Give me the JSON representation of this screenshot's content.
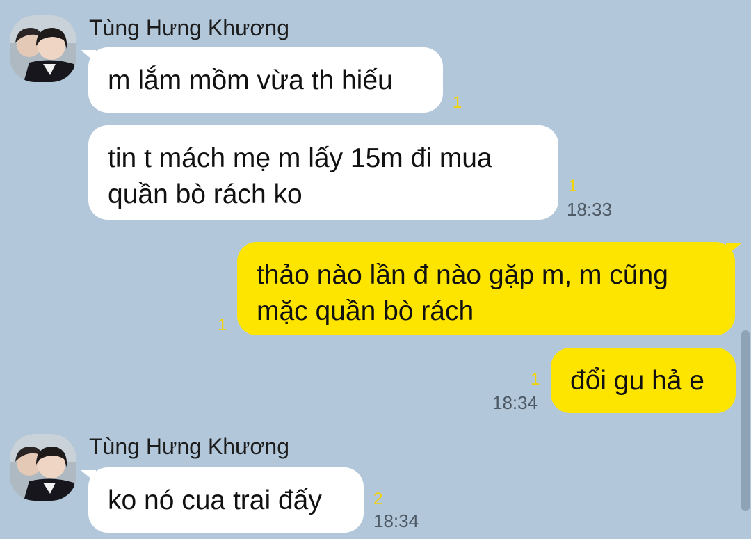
{
  "contact": {
    "name": "Tùng Hưng Khương",
    "avatar_icon": "profile-photo-icon"
  },
  "colors": {
    "background": "#b2c7da",
    "incoming_bubble": "#ffffff",
    "outgoing_bubble": "#fee500",
    "unread": "#f5d400"
  },
  "messages": [
    {
      "direction": "incoming",
      "lines": [
        "m lắm mồm vừa th hiếu"
      ],
      "unread": "1",
      "time": ""
    },
    {
      "direction": "incoming",
      "lines": [
        "tin t mách mẹ m lấy 15m đi mua",
        "quần bò rách ko"
      ],
      "unread": "1",
      "time": "18:33"
    },
    {
      "direction": "outgoing",
      "lines": [
        "thảo nào lần đ nào gặp m, m cũng",
        "mặc quần bò rách"
      ],
      "unread": "1",
      "time": ""
    },
    {
      "direction": "outgoing",
      "lines": [
        "đổi gu hả e"
      ],
      "unread": "1",
      "time": "18:34"
    },
    {
      "direction": "incoming",
      "lines": [
        "ko nó cua trai đấy"
      ],
      "unread": "2",
      "time": "18:34"
    }
  ]
}
